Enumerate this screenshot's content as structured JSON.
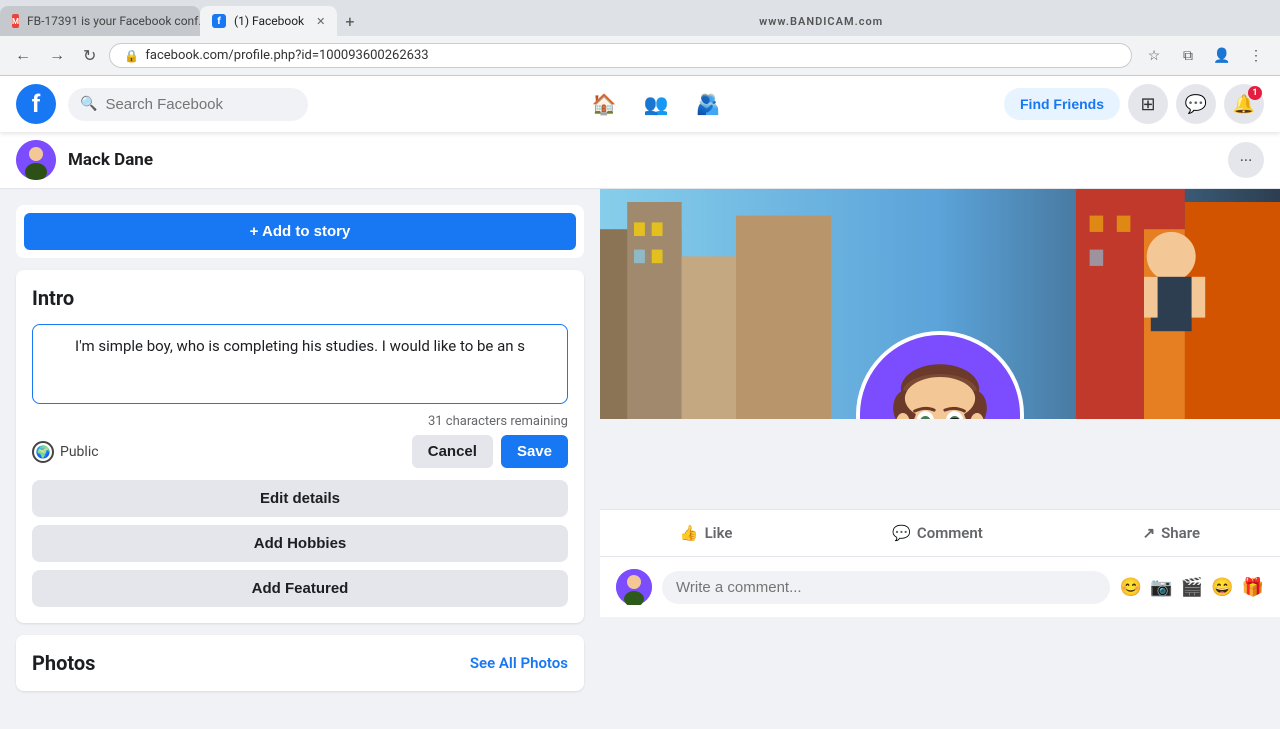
{
  "browser": {
    "tabs": [
      {
        "id": "tab-gmail",
        "label": "FB-17391 is your Facebook conf...",
        "type": "gmail",
        "active": false
      },
      {
        "id": "tab-fb",
        "label": "(1) Facebook",
        "type": "facebook",
        "active": true
      }
    ],
    "new_tab_label": "+",
    "bandicam_text": "www.BANDICAM.com",
    "address": "facebook.com/profile.php?id=100093600262633",
    "nav": {
      "back": "←",
      "forward": "→",
      "reload": "↻"
    }
  },
  "header": {
    "logo": "f",
    "search_placeholder": "Search Facebook",
    "find_friends_label": "Find Friends",
    "nav_icons": [
      "🏠",
      "👥",
      "🫂"
    ],
    "right_icons": [
      "⊞",
      "💬",
      "🔔"
    ]
  },
  "profile_bar": {
    "name": "Mack Dane",
    "more_icon": "···"
  },
  "intro": {
    "title": "Intro",
    "bio_text": "I'm simple boy, who is completing his studies. I would like to be an s",
    "char_remaining": "31 characters remaining",
    "privacy": "Public",
    "cancel_label": "Cancel",
    "save_label": "Save",
    "edit_details_label": "Edit details",
    "add_hobbies_label": "Add Hobbies",
    "add_featured_label": "Add Featured"
  },
  "photos": {
    "title": "Photos",
    "see_all_label": "See All Photos"
  },
  "post_actions": {
    "like_label": "Like",
    "comment_label": "Comment",
    "share_label": "Share"
  },
  "comment": {
    "placeholder": "Write a comment...",
    "icons": [
      "😊",
      "📷",
      "🎬",
      "😄",
      "🎁"
    ]
  },
  "colors": {
    "fb_blue": "#1877f2",
    "purple": "#7c4dff",
    "bg": "#f0f2f5",
    "white": "#ffffff"
  }
}
